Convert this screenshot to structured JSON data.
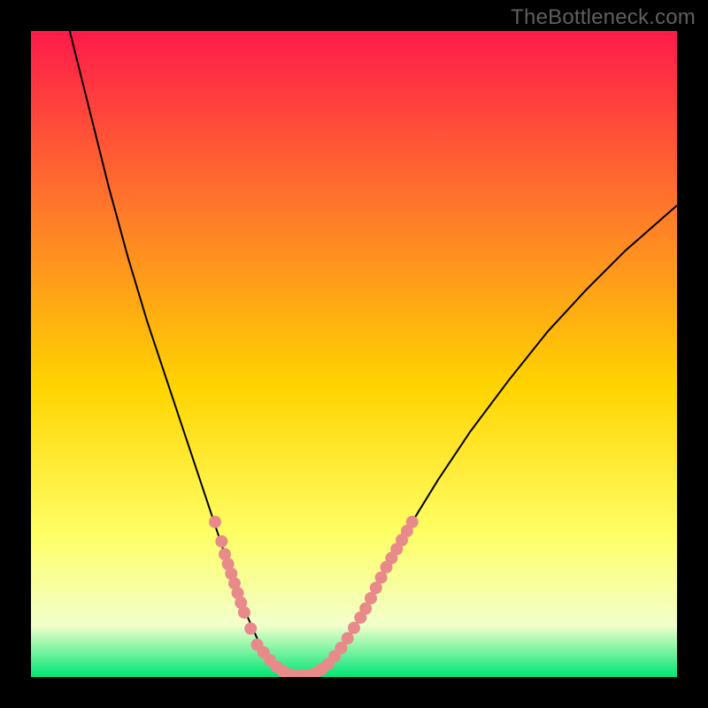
{
  "watermark": "TheBottleneck.com",
  "chart_data": {
    "type": "line",
    "title": "",
    "xlabel": "",
    "ylabel": "",
    "xlim": [
      0,
      100
    ],
    "ylim": [
      0,
      100
    ],
    "gradient_colors": {
      "top": "#ff1a4a",
      "upper_mid": "#ff7a2a",
      "mid": "#ffd400",
      "lower_mid": "#ffff66",
      "near_bottom": "#f2ffcc",
      "bottom": "#00e676"
    },
    "series": [
      {
        "name": "curve",
        "type": "line",
        "color": "#000000",
        "points": [
          {
            "x": 6.0,
            "y": 100.0
          },
          {
            "x": 8.0,
            "y": 92.0
          },
          {
            "x": 10.0,
            "y": 84.0
          },
          {
            "x": 12.0,
            "y": 76.0
          },
          {
            "x": 15.0,
            "y": 65.0
          },
          {
            "x": 18.0,
            "y": 55.0
          },
          {
            "x": 21.0,
            "y": 46.0
          },
          {
            "x": 24.0,
            "y": 37.0
          },
          {
            "x": 27.0,
            "y": 28.0
          },
          {
            "x": 29.0,
            "y": 22.0
          },
          {
            "x": 31.0,
            "y": 16.0
          },
          {
            "x": 33.0,
            "y": 10.5
          },
          {
            "x": 35.0,
            "y": 6.0
          },
          {
            "x": 37.0,
            "y": 2.5
          },
          {
            "x": 39.0,
            "y": 0.8
          },
          {
            "x": 41.0,
            "y": 0.2
          },
          {
            "x": 43.0,
            "y": 0.2
          },
          {
            "x": 45.0,
            "y": 1.0
          },
          {
            "x": 47.0,
            "y": 3.0
          },
          {
            "x": 49.0,
            "y": 6.0
          },
          {
            "x": 52.0,
            "y": 11.0
          },
          {
            "x": 55.0,
            "y": 17.0
          },
          {
            "x": 59.0,
            "y": 24.0
          },
          {
            "x": 63.0,
            "y": 30.5
          },
          {
            "x": 68.0,
            "y": 38.0
          },
          {
            "x": 74.0,
            "y": 46.0
          },
          {
            "x": 80.0,
            "y": 53.5
          },
          {
            "x": 86.0,
            "y": 60.0
          },
          {
            "x": 92.0,
            "y": 66.0
          },
          {
            "x": 100.0,
            "y": 73.0
          }
        ]
      },
      {
        "name": "markers-left",
        "type": "scatter",
        "color": "#e88a8a",
        "points": [
          {
            "x": 28.5,
            "y": 24.0
          },
          {
            "x": 29.5,
            "y": 21.0
          },
          {
            "x": 30.0,
            "y": 19.0
          },
          {
            "x": 30.5,
            "y": 17.5
          },
          {
            "x": 31.0,
            "y": 16.0
          },
          {
            "x": 31.5,
            "y": 14.5
          },
          {
            "x": 32.0,
            "y": 13.0
          },
          {
            "x": 32.5,
            "y": 11.5
          },
          {
            "x": 33.0,
            "y": 10.0
          },
          {
            "x": 34.0,
            "y": 7.5
          },
          {
            "x": 35.0,
            "y": 5.0
          },
          {
            "x": 36.0,
            "y": 3.8
          },
          {
            "x": 37.0,
            "y": 2.6
          },
          {
            "x": 38.0,
            "y": 1.6
          },
          {
            "x": 39.0,
            "y": 0.9
          },
          {
            "x": 40.0,
            "y": 0.4
          },
          {
            "x": 41.0,
            "y": 0.2
          },
          {
            "x": 42.0,
            "y": 0.2
          },
          {
            "x": 43.0,
            "y": 0.3
          },
          {
            "x": 44.0,
            "y": 0.6
          }
        ]
      },
      {
        "name": "markers-right",
        "type": "scatter",
        "color": "#e88a8a",
        "points": [
          {
            "x": 45.0,
            "y": 1.2
          },
          {
            "x": 46.0,
            "y": 2.0
          },
          {
            "x": 47.0,
            "y": 3.2
          },
          {
            "x": 48.0,
            "y": 4.5
          },
          {
            "x": 49.0,
            "y": 6.0
          },
          {
            "x": 50.0,
            "y": 7.6
          },
          {
            "x": 51.0,
            "y": 9.2
          },
          {
            "x": 51.8,
            "y": 10.6
          },
          {
            "x": 52.6,
            "y": 12.2
          },
          {
            "x": 53.4,
            "y": 13.8
          },
          {
            "x": 54.2,
            "y": 15.4
          },
          {
            "x": 55.0,
            "y": 17.0
          },
          {
            "x": 55.8,
            "y": 18.4
          },
          {
            "x": 56.6,
            "y": 19.8
          },
          {
            "x": 57.4,
            "y": 21.2
          },
          {
            "x": 58.2,
            "y": 22.6
          },
          {
            "x": 59.0,
            "y": 24.0
          }
        ]
      }
    ]
  }
}
